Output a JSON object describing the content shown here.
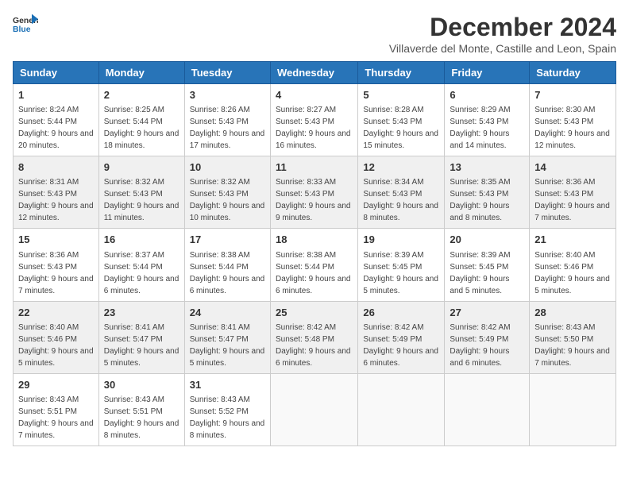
{
  "header": {
    "logo_line1": "General",
    "logo_line2": "Blue",
    "month_title": "December 2024",
    "location": "Villaverde del Monte, Castille and Leon, Spain"
  },
  "weekdays": [
    "Sunday",
    "Monday",
    "Tuesday",
    "Wednesday",
    "Thursday",
    "Friday",
    "Saturday"
  ],
  "weeks": [
    [
      {
        "day": "1",
        "sunrise": "8:24 AM",
        "sunset": "5:44 PM",
        "daylight": "9 hours and 20 minutes."
      },
      {
        "day": "2",
        "sunrise": "8:25 AM",
        "sunset": "5:44 PM",
        "daylight": "9 hours and 18 minutes."
      },
      {
        "day": "3",
        "sunrise": "8:26 AM",
        "sunset": "5:43 PM",
        "daylight": "9 hours and 17 minutes."
      },
      {
        "day": "4",
        "sunrise": "8:27 AM",
        "sunset": "5:43 PM",
        "daylight": "9 hours and 16 minutes."
      },
      {
        "day": "5",
        "sunrise": "8:28 AM",
        "sunset": "5:43 PM",
        "daylight": "9 hours and 15 minutes."
      },
      {
        "day": "6",
        "sunrise": "8:29 AM",
        "sunset": "5:43 PM",
        "daylight": "9 hours and 14 minutes."
      },
      {
        "day": "7",
        "sunrise": "8:30 AM",
        "sunset": "5:43 PM",
        "daylight": "9 hours and 12 minutes."
      }
    ],
    [
      {
        "day": "8",
        "sunrise": "8:31 AM",
        "sunset": "5:43 PM",
        "daylight": "9 hours and 12 minutes."
      },
      {
        "day": "9",
        "sunrise": "8:32 AM",
        "sunset": "5:43 PM",
        "daylight": "9 hours and 11 minutes."
      },
      {
        "day": "10",
        "sunrise": "8:32 AM",
        "sunset": "5:43 PM",
        "daylight": "9 hours and 10 minutes."
      },
      {
        "day": "11",
        "sunrise": "8:33 AM",
        "sunset": "5:43 PM",
        "daylight": "9 hours and 9 minutes."
      },
      {
        "day": "12",
        "sunrise": "8:34 AM",
        "sunset": "5:43 PM",
        "daylight": "9 hours and 8 minutes."
      },
      {
        "day": "13",
        "sunrise": "8:35 AM",
        "sunset": "5:43 PM",
        "daylight": "9 hours and 8 minutes."
      },
      {
        "day": "14",
        "sunrise": "8:36 AM",
        "sunset": "5:43 PM",
        "daylight": "9 hours and 7 minutes."
      }
    ],
    [
      {
        "day": "15",
        "sunrise": "8:36 AM",
        "sunset": "5:43 PM",
        "daylight": "9 hours and 7 minutes."
      },
      {
        "day": "16",
        "sunrise": "8:37 AM",
        "sunset": "5:44 PM",
        "daylight": "9 hours and 6 minutes."
      },
      {
        "day": "17",
        "sunrise": "8:38 AM",
        "sunset": "5:44 PM",
        "daylight": "9 hours and 6 minutes."
      },
      {
        "day": "18",
        "sunrise": "8:38 AM",
        "sunset": "5:44 PM",
        "daylight": "9 hours and 6 minutes."
      },
      {
        "day": "19",
        "sunrise": "8:39 AM",
        "sunset": "5:45 PM",
        "daylight": "9 hours and 5 minutes."
      },
      {
        "day": "20",
        "sunrise": "8:39 AM",
        "sunset": "5:45 PM",
        "daylight": "9 hours and 5 minutes."
      },
      {
        "day": "21",
        "sunrise": "8:40 AM",
        "sunset": "5:46 PM",
        "daylight": "9 hours and 5 minutes."
      }
    ],
    [
      {
        "day": "22",
        "sunrise": "8:40 AM",
        "sunset": "5:46 PM",
        "daylight": "9 hours and 5 minutes."
      },
      {
        "day": "23",
        "sunrise": "8:41 AM",
        "sunset": "5:47 PM",
        "daylight": "9 hours and 5 minutes."
      },
      {
        "day": "24",
        "sunrise": "8:41 AM",
        "sunset": "5:47 PM",
        "daylight": "9 hours and 5 minutes."
      },
      {
        "day": "25",
        "sunrise": "8:42 AM",
        "sunset": "5:48 PM",
        "daylight": "9 hours and 6 minutes."
      },
      {
        "day": "26",
        "sunrise": "8:42 AM",
        "sunset": "5:49 PM",
        "daylight": "9 hours and 6 minutes."
      },
      {
        "day": "27",
        "sunrise": "8:42 AM",
        "sunset": "5:49 PM",
        "daylight": "9 hours and 6 minutes."
      },
      {
        "day": "28",
        "sunrise": "8:43 AM",
        "sunset": "5:50 PM",
        "daylight": "9 hours and 7 minutes."
      }
    ],
    [
      {
        "day": "29",
        "sunrise": "8:43 AM",
        "sunset": "5:51 PM",
        "daylight": "9 hours and 7 minutes."
      },
      {
        "day": "30",
        "sunrise": "8:43 AM",
        "sunset": "5:51 PM",
        "daylight": "9 hours and 8 minutes."
      },
      {
        "day": "31",
        "sunrise": "8:43 AM",
        "sunset": "5:52 PM",
        "daylight": "9 hours and 8 minutes."
      },
      null,
      null,
      null,
      null
    ]
  ],
  "labels": {
    "sunrise": "Sunrise:",
    "sunset": "Sunset:",
    "daylight": "Daylight:"
  }
}
